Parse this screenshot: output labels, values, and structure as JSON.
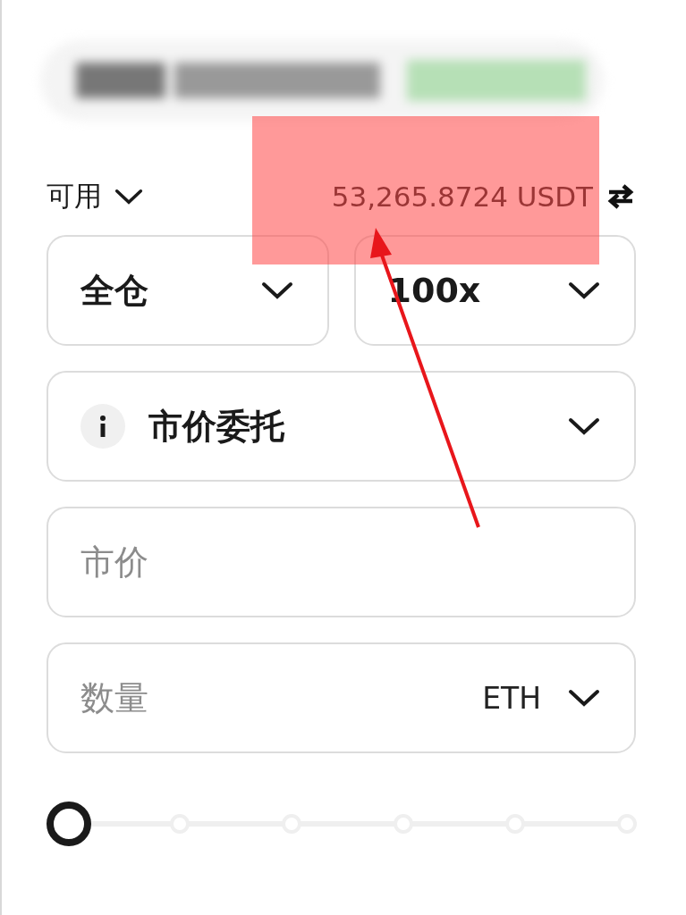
{
  "balance": {
    "label": "可用",
    "value": "53,265.8724 USDT"
  },
  "margin_mode": {
    "value": "全仓"
  },
  "leverage": {
    "value": "100x"
  },
  "order_type": {
    "value": "市价委托"
  },
  "price_field": {
    "placeholder": "市价"
  },
  "quantity_field": {
    "placeholder": "数量",
    "unit": "ETH"
  },
  "slider": {
    "level": 0
  }
}
